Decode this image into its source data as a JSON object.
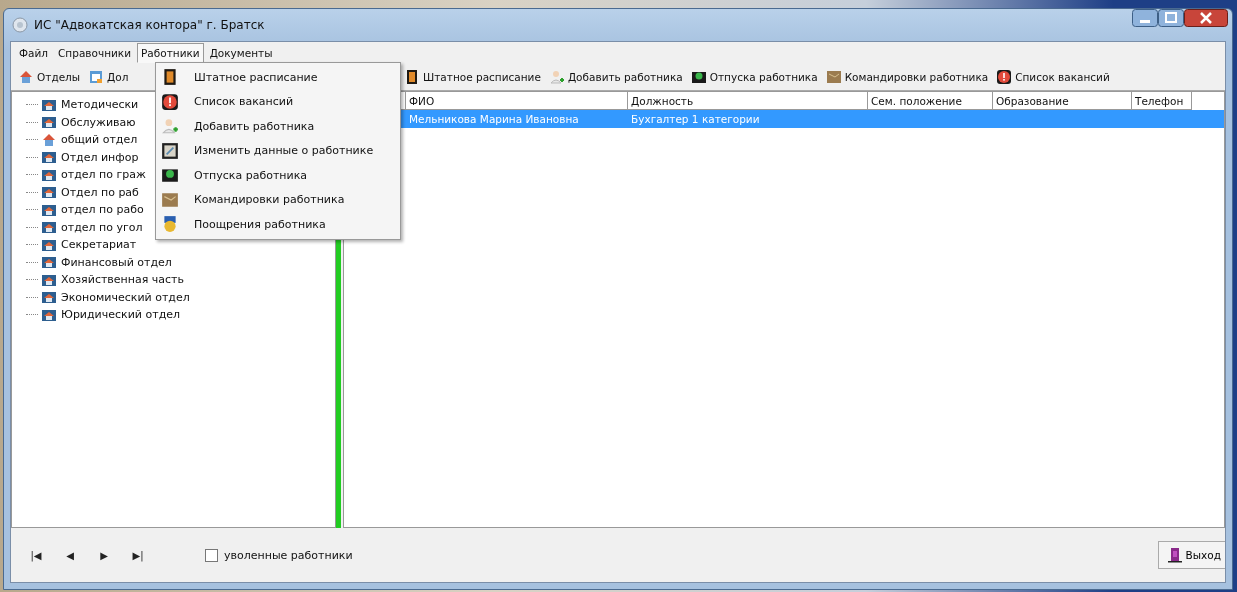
{
  "window": {
    "title": "ИС \"Адвокатская контора\" г. Братск"
  },
  "menu_bar": [
    {
      "label": "Файл",
      "selected": false
    },
    {
      "label": "Справочники",
      "selected": false
    },
    {
      "label": "Работники",
      "selected": true
    },
    {
      "label": "Документы",
      "selected": false
    }
  ],
  "toolbar_left": [
    {
      "label": "Отделы",
      "kind": "house"
    },
    {
      "label": "Дол",
      "kind": "calendar"
    }
  ],
  "toolbar_right": [
    {
      "label": "Штатное расписание",
      "kind": "schedule"
    },
    {
      "label": "Добавить работника",
      "kind": "person"
    },
    {
      "label": "Отпуска работника",
      "kind": "vacation"
    },
    {
      "label": "Командировки работника",
      "kind": "trip"
    },
    {
      "label": "Список вакансий",
      "kind": "alert"
    }
  ],
  "tree": [
    {
      "label": "Методически",
      "kind": "folder"
    },
    {
      "label": "Обслуживаю",
      "kind": "folder"
    },
    {
      "label": "общий отдел",
      "kind": "house"
    },
    {
      "label": "Отдел инфор",
      "kind": "folder"
    },
    {
      "label": "отдел по граж",
      "kind": "folder"
    },
    {
      "label": "Отдел по раб",
      "kind": "folder"
    },
    {
      "label": "отдел по рабо",
      "kind": "folder"
    },
    {
      "label": "отдел по угол",
      "kind": "folder"
    },
    {
      "label": "Секретариат",
      "kind": "folder"
    },
    {
      "label": "Финансовый отдел",
      "kind": "folder"
    },
    {
      "label": "Хозяйственная часть",
      "kind": "folder"
    },
    {
      "label": "Экономический отдел",
      "kind": "folder"
    },
    {
      "label": "Юридический отдел",
      "kind": "folder"
    }
  ],
  "table": {
    "columns": [
      "ФИО",
      "Должность",
      "Сем. положение",
      "Образование",
      "Телефон"
    ],
    "rows": [
      {
        "cells": [
          "Мельникова Марина Ивановна",
          "Бухгалтер  1 категории",
          "",
          "",
          ""
        ],
        "selected": true
      }
    ]
  },
  "dropdown_menu": [
    {
      "label": "Штатное расписание",
      "kind": "schedule"
    },
    {
      "label": "Список вакансий",
      "kind": "alert"
    },
    {
      "label": "Добавить работника",
      "kind": "person"
    },
    {
      "label": "Изменить данные о работнике",
      "kind": "edit"
    },
    {
      "label": "Отпуска работника",
      "kind": "vacation"
    },
    {
      "label": "Командировки работника",
      "kind": "trip"
    },
    {
      "label": "Поощрения работника",
      "kind": "medal"
    }
  ],
  "navigation": [
    "|◀",
    "◀",
    "▶",
    "▶|"
  ],
  "fired_checkbox": {
    "label": "уволенные работники",
    "checked": false
  },
  "exit_button": {
    "label": "Выход"
  }
}
